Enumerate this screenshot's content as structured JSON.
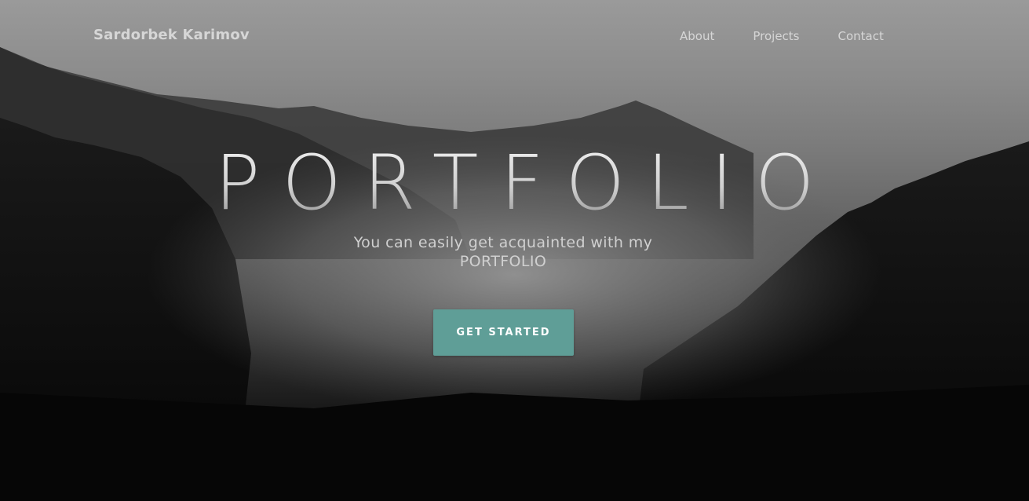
{
  "header": {
    "brand": "Sardorbek Karimov",
    "nav": [
      {
        "label": "About"
      },
      {
        "label": "Projects"
      },
      {
        "label": "Contact"
      }
    ]
  },
  "hero": {
    "title": "PORTFOLIO",
    "subtitle": "You can easily get acquainted with my PORTFOLIO",
    "cta_label": "GET STARTED"
  },
  "colors": {
    "accent": "#5f9e97",
    "nav_text": "#d6d6d6"
  }
}
